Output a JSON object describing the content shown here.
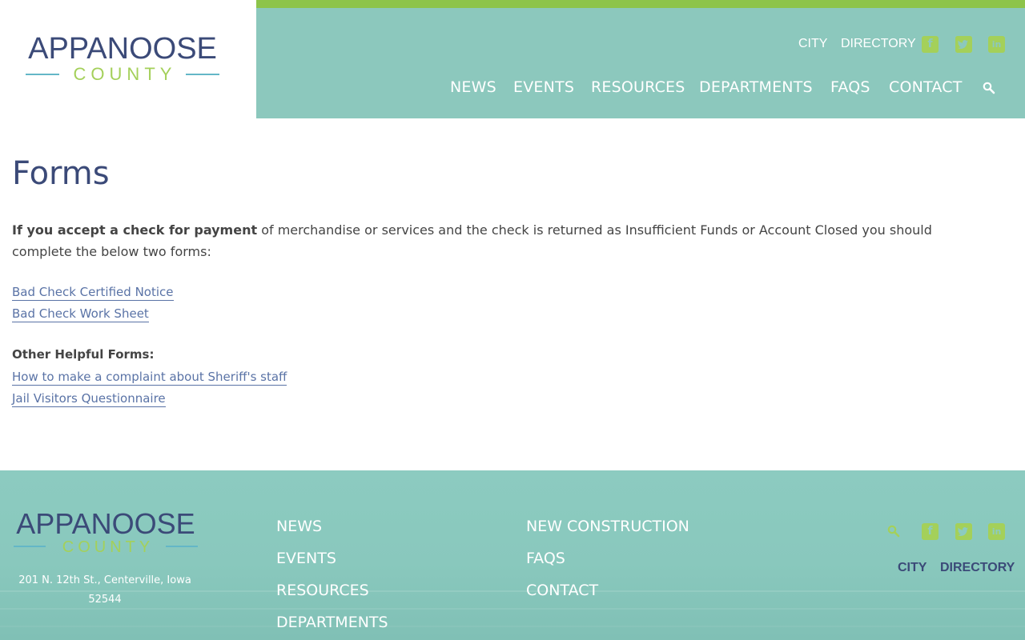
{
  "brand": {
    "name_top": "APPANOOSE",
    "name_bottom": "COUNTY"
  },
  "header": {
    "utility_links": [
      {
        "label": "CITY"
      },
      {
        "label": "DIRECTORY"
      }
    ],
    "social_icons": [
      "facebook-icon",
      "twitter-icon",
      "linkedin-icon"
    ],
    "main_nav": [
      {
        "label": "NEWS"
      },
      {
        "label": "EVENTS"
      },
      {
        "label": "RESOURCES"
      },
      {
        "label": "DEPARTMENTS"
      },
      {
        "label": "FAQS"
      },
      {
        "label": "CONTACT"
      }
    ]
  },
  "page": {
    "title": "Forms",
    "intro_bold": "If you accept a check for payment",
    "intro_rest": " of merchandise or services and the check is returned as Insufficient Funds or Account Closed you should complete the below two forms:",
    "links_primary": [
      {
        "label": "Bad Check Certified Notice"
      },
      {
        "label": "Bad Check Work Sheet"
      }
    ],
    "other_heading": "Other Helpful Forms:",
    "links_other": [
      {
        "label": "How to make a complaint about Sheriff's staff"
      },
      {
        "label": "Jail Visitors Questionnaire"
      }
    ]
  },
  "footer": {
    "address": "201 N. 12th St., Centerville, Iowa 52544",
    "nav_col1": [
      {
        "label": "NEWS"
      },
      {
        "label": "EVENTS"
      },
      {
        "label": "RESOURCES"
      },
      {
        "label": "DEPARTMENTS"
      }
    ],
    "nav_col2": [
      {
        "label": "NEW CONSTRUCTION"
      },
      {
        "label": "FAQS"
      },
      {
        "label": "CONTACT"
      }
    ],
    "utility_links": [
      {
        "label": "CITY"
      },
      {
        "label": "DIRECTORY"
      }
    ]
  },
  "colors": {
    "header_teal": "#8cc8bd",
    "accent_green": "#8dc44a",
    "brand_navy": "#3b4a78",
    "brand_lime": "#a4d05a",
    "link_blue": "#5a73a6"
  }
}
